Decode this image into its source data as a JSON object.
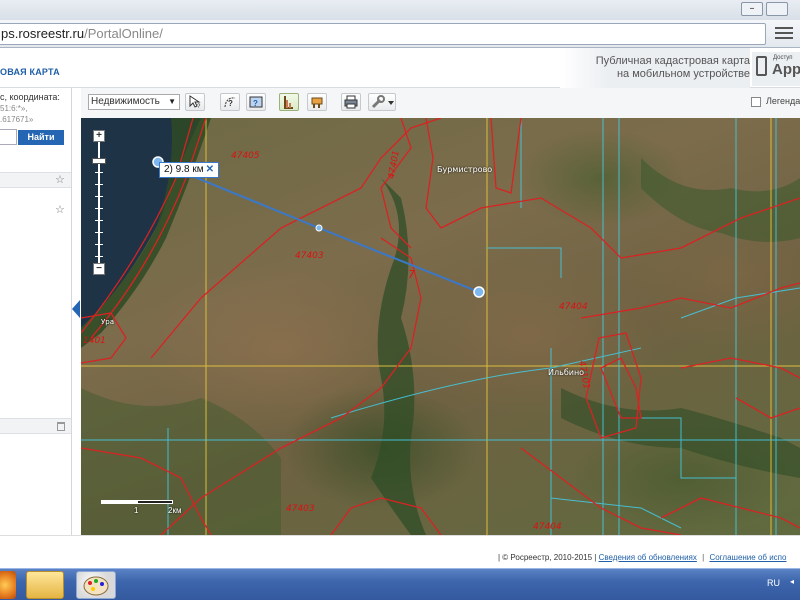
{
  "browser": {
    "address": {
      "prefix": "ps.rosreestr.ru",
      "path": "/PortalOnline/"
    },
    "minimize_label": "–"
  },
  "header": {
    "portal_title": "ОВАЯ КАРТА",
    "mobile_line1": "Публичная кадастровая карта",
    "mobile_line2": "на мобильном устройстве",
    "app_small": "Доступ",
    "app_label": "App"
  },
  "sidebar": {
    "hint_line1": "с, координата:",
    "hint_line2": "51:6:*»,",
    "hint_line3": ".617671»",
    "find_label": "Найти",
    "star_icon": "☆"
  },
  "toolbar": {
    "layer_select": "Недвижимость",
    "legend_label": "Легенда"
  },
  "map": {
    "measure_label": "2) 9.8 км",
    "measure_close": "✕",
    "labels": {
      "l47405": "47405",
      "l47403a": "47403",
      "l47403b": "47403",
      "l47404a": "47404",
      "l47404b": "47404",
      "l7": "7",
      "l1401": "1401",
      "l47401": "47401",
      "l47101": "47101",
      "burmistrovo": "Бурмистрово",
      "ilbino": "Ильбино",
      "town_w": "Ура"
    },
    "scale_mid": "1",
    "scale_end": "2км"
  },
  "footer": {
    "copyright": "| © Росреестр, 2010-2015 |",
    "link1": "Сведения об обновлениях",
    "link2": "Соглашение об испо"
  },
  "taskbar": {
    "lang": "RU",
    "tray_arrow": "◂"
  }
}
